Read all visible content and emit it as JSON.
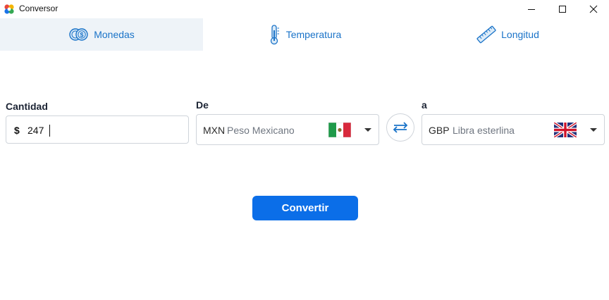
{
  "window": {
    "title": "Conversor",
    "controls": {
      "minimize": "—",
      "maximize": "☐",
      "close": "✕"
    }
  },
  "tabs": [
    {
      "label": "Monedas",
      "icon": "coins-icon",
      "active": true
    },
    {
      "label": "Temperatura",
      "icon": "thermometer-icon",
      "active": false
    },
    {
      "label": "Longitud",
      "icon": "ruler-icon",
      "active": false
    }
  ],
  "form": {
    "amount": {
      "label": "Cantidad",
      "symbol": "$",
      "value": "247"
    },
    "from": {
      "label": "De",
      "code": "MXN",
      "name": "Peso Mexicano",
      "flag": "mexico-flag"
    },
    "to": {
      "label": "a",
      "code": "GBP",
      "name": "Libra esterlina",
      "flag": "uk-flag"
    },
    "swap_icon": "swap-arrows-icon",
    "convert_label": "Convertir"
  },
  "colors": {
    "accent": "#0b6ee8",
    "tab_active_bg": "#eef3f8",
    "tab_text": "#1a73c8"
  }
}
